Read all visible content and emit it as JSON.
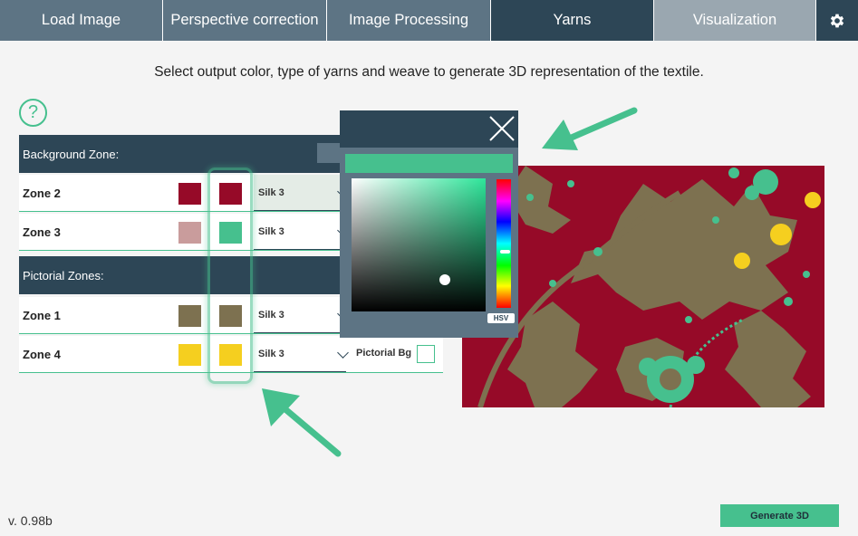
{
  "tabs": {
    "load": "Load Image",
    "perspective": "Perspective correction",
    "processing": "Image Processing",
    "yarns": "Yarns",
    "visualization": "Visualization",
    "settings_icon": "gear-icon"
  },
  "instruction": "Select output color, type of yarns and weave to generate 3D representation of the textile.",
  "help": {
    "icon": "question-circle-icon",
    "glyph": "?"
  },
  "background_section": {
    "title": "Background Zone:",
    "rows": [
      {
        "label": "Zone 2",
        "input_color": "#960a28",
        "output_color": "#960a28",
        "yarn": "Silk 3"
      },
      {
        "label": "Zone 3",
        "input_color": "#c99c9c",
        "output_color": "#46c08e",
        "yarn": "Silk 3"
      }
    ]
  },
  "pictorial_section": {
    "title": "Pictorial Zones:",
    "rows": [
      {
        "label": "Zone 1",
        "input_color": "#7d7150",
        "output_color": "#7d7150",
        "yarn": "Silk 3"
      },
      {
        "label": "Zone 4",
        "input_color": "#f5cf1f",
        "output_color": "#f5cf1f",
        "yarn": "Silk 3"
      }
    ],
    "pictorial_bg_label": "Pictorial Bg"
  },
  "color_picker": {
    "selected_color": "#46c08e",
    "mode_label": "HSV",
    "close_icon": "close-icon"
  },
  "textile": {
    "background": "#960a28",
    "motif_olive": "#7d7150",
    "motif_green": "#46c08e",
    "motif_yellow": "#f5cf1f"
  },
  "accent_color": "#46c08e",
  "version": "v. 0.98b",
  "generate_button": "Generate 3D"
}
